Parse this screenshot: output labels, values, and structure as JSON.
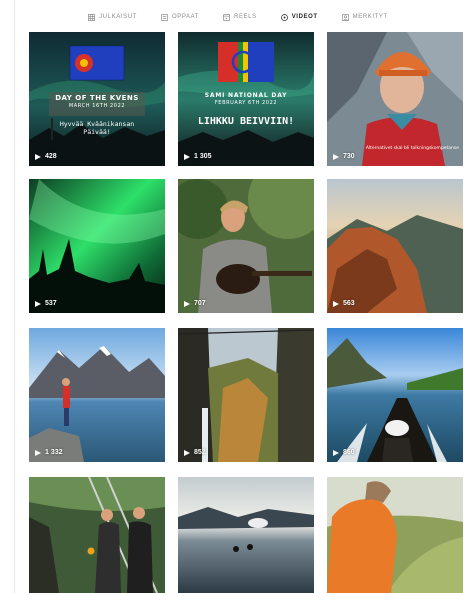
{
  "tabs": [
    {
      "label": "JULKAISUT",
      "icon": "grid-icon",
      "active": false
    },
    {
      "label": "OPPAAT",
      "icon": "guide-icon",
      "active": false
    },
    {
      "label": "REELS",
      "icon": "reels-icon",
      "active": false
    },
    {
      "label": "VIDEOT",
      "icon": "video-icon",
      "active": true
    },
    {
      "label": "MERKITYT",
      "icon": "tag-icon",
      "active": false
    }
  ],
  "videos": [
    {
      "views": "428",
      "overlay": {
        "line1": "DAY OF THE KVENS",
        "line2": "MARCH 16TH 2022",
        "line3": "Hyvvää Kväänikansan",
        "line4": "Päivää!"
      }
    },
    {
      "views": "1 305",
      "overlay": {
        "line1": "SAMI NATIONAL DAY",
        "line2": "FEBRUARY 6TH 2022",
        "line3": "LIHKKU BEIVVIIN!"
      }
    },
    {
      "views": "730",
      "overlay": {
        "line1": "Alternativet skal bli tolkningskompetanse"
      }
    },
    {
      "views": "537"
    },
    {
      "views": "707"
    },
    {
      "views": "563"
    },
    {
      "views": "1 332"
    },
    {
      "views": "852"
    },
    {
      "views": "860"
    },
    {
      "views": ""
    },
    {
      "views": ""
    },
    {
      "views": ""
    }
  ]
}
